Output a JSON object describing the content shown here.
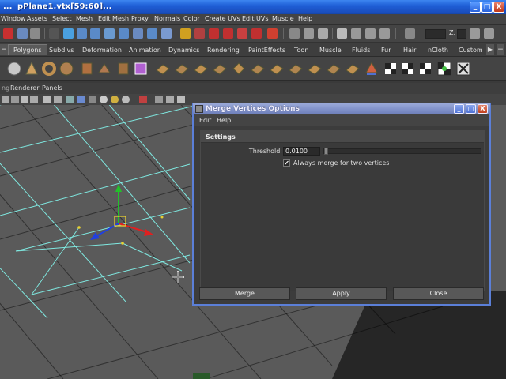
{
  "app_window": {
    "title_left": "...",
    "title": "pPlane1.vtx[59:60]...",
    "minimize_glyph": "_",
    "maximize_glyph": "□",
    "close_glyph": "X"
  },
  "menubar": {
    "items": [
      "Window",
      "Assets",
      "Select",
      "Mesh",
      "Edit Mesh",
      "Proxy",
      "Normals",
      "Color",
      "Create UVs",
      "Edit UVs",
      "Muscle",
      "Help"
    ]
  },
  "statusline": {
    "xyz_label": "Z:"
  },
  "shelf_tabs": {
    "items": [
      "Polygons",
      "Subdivs",
      "Deformation",
      "Animation",
      "Dynamics",
      "Rendering",
      "PaintEffects",
      "Toon",
      "Muscle",
      "Fluids",
      "Fur",
      "Hair",
      "nCloth",
      "Custom"
    ],
    "active": "Polygons"
  },
  "panel_menu": {
    "items": [
      "Renderer",
      "Panels"
    ]
  },
  "dialog": {
    "title": "Merge Vertices Options",
    "menu": [
      "Edit",
      "Help"
    ],
    "section_title": "Settings",
    "threshold_label": "Threshold:",
    "threshold_value": "0.0100",
    "threshold_slider_fraction": 0.0,
    "always_merge_label": "Always merge for two vertices",
    "always_merge_checked": true,
    "buttons": {
      "merge": "Merge",
      "apply": "Apply",
      "close": "Close"
    }
  },
  "colors": {
    "xp_title_blue": "#1f5fd6",
    "dialog_border": "#5b7fd8",
    "grid_line": "#7fe8e0",
    "vertex_yellow": "#e8d030",
    "manip_green": "#22c02a",
    "manip_red": "#e02020",
    "manip_blue": "#2040e0"
  }
}
